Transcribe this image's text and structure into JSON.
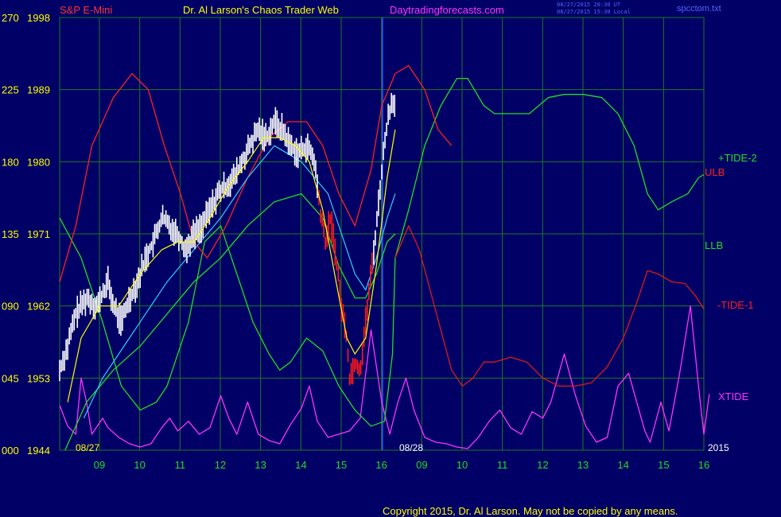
{
  "header": {
    "instrument": "S&P E-Mini",
    "title": "Dr. Al Larson's Chaos Trader Web",
    "site": "Daytradingforecasts.com",
    "stamp_1": "08/27/2015 20:30 UT",
    "stamp_2": "08/27/2015 15:30 Local",
    "file": "spcctom.txt"
  },
  "footer": {
    "copyright": "Copyright 2015, Dr. Al Larson. May not be copied by any means."
  },
  "colors": {
    "background": "#000066",
    "grid": "#1e7a1e",
    "axis_text": "#ffff00",
    "price": "#ffffff",
    "ulb": "#ff2020",
    "llb": "#22dd22",
    "tide2": "#22dd22",
    "tide1": "#dd1a1a",
    "xtide": "#ff33ff",
    "cyan_avg": "#33ccff",
    "yellow_avg": "#ffff00",
    "divider": "#3355ff"
  },
  "chart_data": {
    "type": "line",
    "ylim_price": [
      1944,
      1998
    ],
    "ylim_tide": [
      0,
      270
    ],
    "y_ticks_left": [
      "270",
      "225",
      "180",
      "135",
      "090",
      "045",
      "000"
    ],
    "y_ticks_right": [
      "1998",
      "1989",
      "1980",
      "1971",
      "1962",
      "1953",
      "1944"
    ],
    "x_tick_labels": [
      "09",
      "10",
      "11",
      "12",
      "13",
      "14",
      "15",
      "16",
      "09",
      "10",
      "11",
      "12",
      "13",
      "14",
      "15",
      "16"
    ],
    "date_labels": {
      "start": "08/27",
      "forecast_start": "08/28",
      "year": "2015"
    },
    "series_labels": {
      "tide2": "+TIDE-2",
      "ulb": "ULB",
      "llb": "LLB",
      "tide1": "-TIDE-1",
      "xtide": "XTIDE"
    },
    "price_close": [
      [
        0,
        1954
      ],
      [
        0.3,
        1957
      ],
      [
        0.6,
        1961
      ],
      [
        1.0,
        1963
      ],
      [
        1.4,
        1962
      ],
      [
        1.8,
        1965
      ],
      [
        2.0,
        1962
      ],
      [
        2.3,
        1960
      ],
      [
        2.6,
        1963
      ],
      [
        2.9,
        1965
      ],
      [
        3.2,
        1968
      ],
      [
        3.5,
        1970
      ],
      [
        3.8,
        1973
      ],
      [
        4.1,
        1972
      ],
      [
        4.4,
        1971
      ],
      [
        4.7,
        1969
      ],
      [
        5.0,
        1971
      ],
      [
        5.3,
        1972
      ],
      [
        5.6,
        1974
      ],
      [
        5.9,
        1976
      ],
      [
        6.2,
        1977
      ],
      [
        6.5,
        1978
      ],
      [
        6.8,
        1980
      ],
      [
        7.1,
        1982
      ],
      [
        7.4,
        1984
      ],
      [
        7.7,
        1983
      ],
      [
        8.0,
        1985
      ],
      [
        8.3,
        1984
      ],
      [
        8.6,
        1982
      ],
      [
        8.9,
        1981
      ],
      [
        9.2,
        1982
      ],
      [
        9.5,
        1980
      ],
      [
        9.7,
        1974
      ],
      [
        9.9,
        1970
      ],
      [
        10.1,
        1973
      ],
      [
        10.3,
        1968
      ],
      [
        10.5,
        1962
      ],
      [
        10.7,
        1958
      ],
      [
        10.8,
        1953
      ],
      [
        11.0,
        1955
      ],
      [
        11.2,
        1954
      ],
      [
        11.4,
        1960
      ],
      [
        11.6,
        1966
      ],
      [
        11.8,
        1972
      ],
      [
        12.0,
        1979
      ],
      [
        12.2,
        1985
      ],
      [
        12.4,
        1988
      ],
      [
        12.5,
        1987
      ]
    ],
    "price_highs_lows_spread": 1.6,
    "ulb": [
      [
        0,
        1965
      ],
      [
        0.6,
        1972
      ],
      [
        1.2,
        1982
      ],
      [
        2.0,
        1988
      ],
      [
        2.7,
        1991
      ],
      [
        3.3,
        1989
      ],
      [
        3.9,
        1982
      ],
      [
        4.5,
        1976
      ],
      [
        5.0,
        1970
      ],
      [
        5.5,
        1968
      ],
      [
        6.2,
        1972
      ],
      [
        7.0,
        1978
      ],
      [
        7.8,
        1983
      ],
      [
        8.5,
        1985
      ],
      [
        9.2,
        1985
      ],
      [
        9.8,
        1982
      ],
      [
        10.4,
        1976
      ],
      [
        11.0,
        1972
      ],
      [
        11.6,
        1979
      ],
      [
        12.0,
        1987
      ],
      [
        12.5,
        1991
      ],
      [
        13.0,
        1992
      ],
      [
        13.6,
        1989
      ],
      [
        14.1,
        1984
      ],
      [
        14.6,
        1982
      ]
    ],
    "llb": [
      [
        0.2,
        1944
      ],
      [
        1.0,
        1950
      ],
      [
        2.0,
        1954
      ],
      [
        3.0,
        1957
      ],
      [
        4.0,
        1961
      ],
      [
        5.0,
        1965
      ],
      [
        6.0,
        1968
      ],
      [
        7.0,
        1972
      ],
      [
        8.0,
        1975
      ],
      [
        9.0,
        1976
      ],
      [
        9.8,
        1973
      ],
      [
        10.4,
        1967
      ],
      [
        11.0,
        1963
      ],
      [
        11.4,
        1963
      ],
      [
        11.8,
        1966
      ],
      [
        12.2,
        1970
      ],
      [
        12.5,
        1971
      ]
    ],
    "cyan_avg": [
      [
        0.9,
        1948
      ],
      [
        1.6,
        1953
      ],
      [
        2.4,
        1957
      ],
      [
        3.2,
        1961
      ],
      [
        4.0,
        1965
      ],
      [
        5.0,
        1969
      ],
      [
        6.0,
        1973
      ],
      [
        7.0,
        1978
      ],
      [
        8.0,
        1982
      ],
      [
        9.0,
        1980
      ],
      [
        10.0,
        1976
      ],
      [
        10.6,
        1970
      ],
      [
        11.0,
        1966
      ],
      [
        11.4,
        1964
      ],
      [
        11.8,
        1968
      ],
      [
        12.2,
        1973
      ],
      [
        12.5,
        1976
      ]
    ],
    "yellow_avg": [
      [
        0.3,
        1950
      ],
      [
        0.8,
        1958
      ],
      [
        1.5,
        1962
      ],
      [
        2.2,
        1962
      ],
      [
        3.0,
        1966
      ],
      [
        3.8,
        1969
      ],
      [
        4.4,
        1970
      ],
      [
        5.0,
        1970
      ],
      [
        5.6,
        1973
      ],
      [
        6.3,
        1977
      ],
      [
        7.0,
        1980
      ],
      [
        7.6,
        1983
      ],
      [
        8.2,
        1983
      ],
      [
        8.8,
        1982
      ],
      [
        9.3,
        1980
      ],
      [
        9.8,
        1974
      ],
      [
        10.3,
        1965
      ],
      [
        10.7,
        1958
      ],
      [
        11.0,
        1956
      ],
      [
        11.4,
        1958
      ],
      [
        11.8,
        1967
      ],
      [
        12.2,
        1978
      ],
      [
        12.5,
        1984
      ]
    ],
    "tide2": [
      [
        0,
        145
      ],
      [
        0.8,
        120
      ],
      [
        1.6,
        80
      ],
      [
        2.3,
        40
      ],
      [
        3.0,
        25
      ],
      [
        3.6,
        30
      ],
      [
        4.0,
        40
      ],
      [
        4.8,
        80
      ],
      [
        5.4,
        130
      ],
      [
        6.0,
        140
      ],
      [
        6.6,
        110
      ],
      [
        7.2,
        80
      ],
      [
        7.8,
        60
      ],
      [
        8.2,
        50
      ],
      [
        8.6,
        55
      ],
      [
        9.2,
        70
      ],
      [
        9.8,
        62
      ],
      [
        10.4,
        40
      ],
      [
        11.0,
        25
      ],
      [
        11.6,
        15
      ],
      [
        12.1,
        18
      ],
      [
        12.4,
        60
      ],
      [
        12.5,
        120
      ],
      [
        13.0,
        150
      ],
      [
        13.6,
        190
      ],
      [
        14.2,
        215
      ],
      [
        14.8,
        232
      ],
      [
        15.2,
        232
      ],
      [
        15.8,
        215
      ],
      [
        16.2,
        210
      ],
      [
        16.8,
        210
      ],
      [
        17.5,
        210
      ],
      [
        18.2,
        220
      ],
      [
        18.8,
        222
      ],
      [
        19.5,
        222
      ],
      [
        20.2,
        220
      ],
      [
        20.8,
        210
      ],
      [
        21.4,
        190
      ],
      [
        21.9,
        160
      ],
      [
        22.3,
        150
      ],
      [
        22.8,
        155
      ],
      [
        23.4,
        160
      ],
      [
        23.8,
        170
      ],
      [
        24.0,
        172
      ]
    ],
    "tide1": [
      [
        12.5,
        120
      ],
      [
        13.0,
        140
      ],
      [
        13.4,
        125
      ],
      [
        13.8,
        100
      ],
      [
        14.2,
        75
      ],
      [
        14.6,
        50
      ],
      [
        15.0,
        40
      ],
      [
        15.4,
        45
      ],
      [
        15.8,
        55
      ],
      [
        16.2,
        55
      ],
      [
        16.8,
        58
      ],
      [
        17.4,
        55
      ],
      [
        18.0,
        45
      ],
      [
        18.6,
        40
      ],
      [
        19.2,
        40
      ],
      [
        19.8,
        42
      ],
      [
        20.4,
        52
      ],
      [
        21.0,
        70
      ],
      [
        21.5,
        92
      ],
      [
        21.9,
        112
      ],
      [
        22.3,
        110
      ],
      [
        22.8,
        105
      ],
      [
        23.3,
        104
      ],
      [
        23.7,
        96
      ],
      [
        24.0,
        88
      ]
    ],
    "xtide": [
      [
        0,
        28
      ],
      [
        0.3,
        15
      ],
      [
        0.6,
        10
      ],
      [
        0.8,
        45
      ],
      [
        1.0,
        30
      ],
      [
        1.2,
        10
      ],
      [
        1.6,
        20
      ],
      [
        1.8,
        14
      ],
      [
        2.2,
        8
      ],
      [
        2.6,
        4
      ],
      [
        3.0,
        2
      ],
      [
        3.4,
        4
      ],
      [
        3.8,
        14
      ],
      [
        4.1,
        20
      ],
      [
        4.4,
        12
      ],
      [
        4.8,
        18
      ],
      [
        5.2,
        10
      ],
      [
        5.6,
        14
      ],
      [
        6.0,
        34
      ],
      [
        6.3,
        20
      ],
      [
        6.6,
        10
      ],
      [
        7.0,
        30
      ],
      [
        7.4,
        10
      ],
      [
        7.8,
        6
      ],
      [
        8.2,
        4
      ],
      [
        8.6,
        16
      ],
      [
        9.0,
        26
      ],
      [
        9.3,
        40
      ],
      [
        9.6,
        18
      ],
      [
        10.0,
        8
      ],
      [
        10.4,
        10
      ],
      [
        10.8,
        12
      ],
      [
        11.2,
        20
      ],
      [
        11.6,
        75
      ],
      [
        12.0,
        30
      ],
      [
        12.3,
        10
      ],
      [
        12.6,
        30
      ],
      [
        12.9,
        45
      ],
      [
        13.2,
        25
      ],
      [
        13.6,
        8
      ],
      [
        14.0,
        5
      ],
      [
        14.4,
        4
      ],
      [
        14.8,
        2
      ],
      [
        15.2,
        1
      ],
      [
        15.6,
        8
      ],
      [
        16.0,
        18
      ],
      [
        16.4,
        25
      ],
      [
        16.8,
        14
      ],
      [
        17.2,
        10
      ],
      [
        17.6,
        24
      ],
      [
        18.0,
        20
      ],
      [
        18.3,
        30
      ],
      [
        18.8,
        60
      ],
      [
        19.2,
        35
      ],
      [
        19.6,
        15
      ],
      [
        20.0,
        5
      ],
      [
        20.4,
        8
      ],
      [
        20.8,
        40
      ],
      [
        21.2,
        48
      ],
      [
        21.5,
        30
      ],
      [
        21.8,
        12
      ],
      [
        22.0,
        5
      ],
      [
        22.4,
        30
      ],
      [
        22.7,
        12
      ],
      [
        23.1,
        48
      ],
      [
        23.5,
        90
      ],
      [
        23.8,
        40
      ],
      [
        24.0,
        10
      ],
      [
        24.2,
        35
      ]
    ]
  }
}
